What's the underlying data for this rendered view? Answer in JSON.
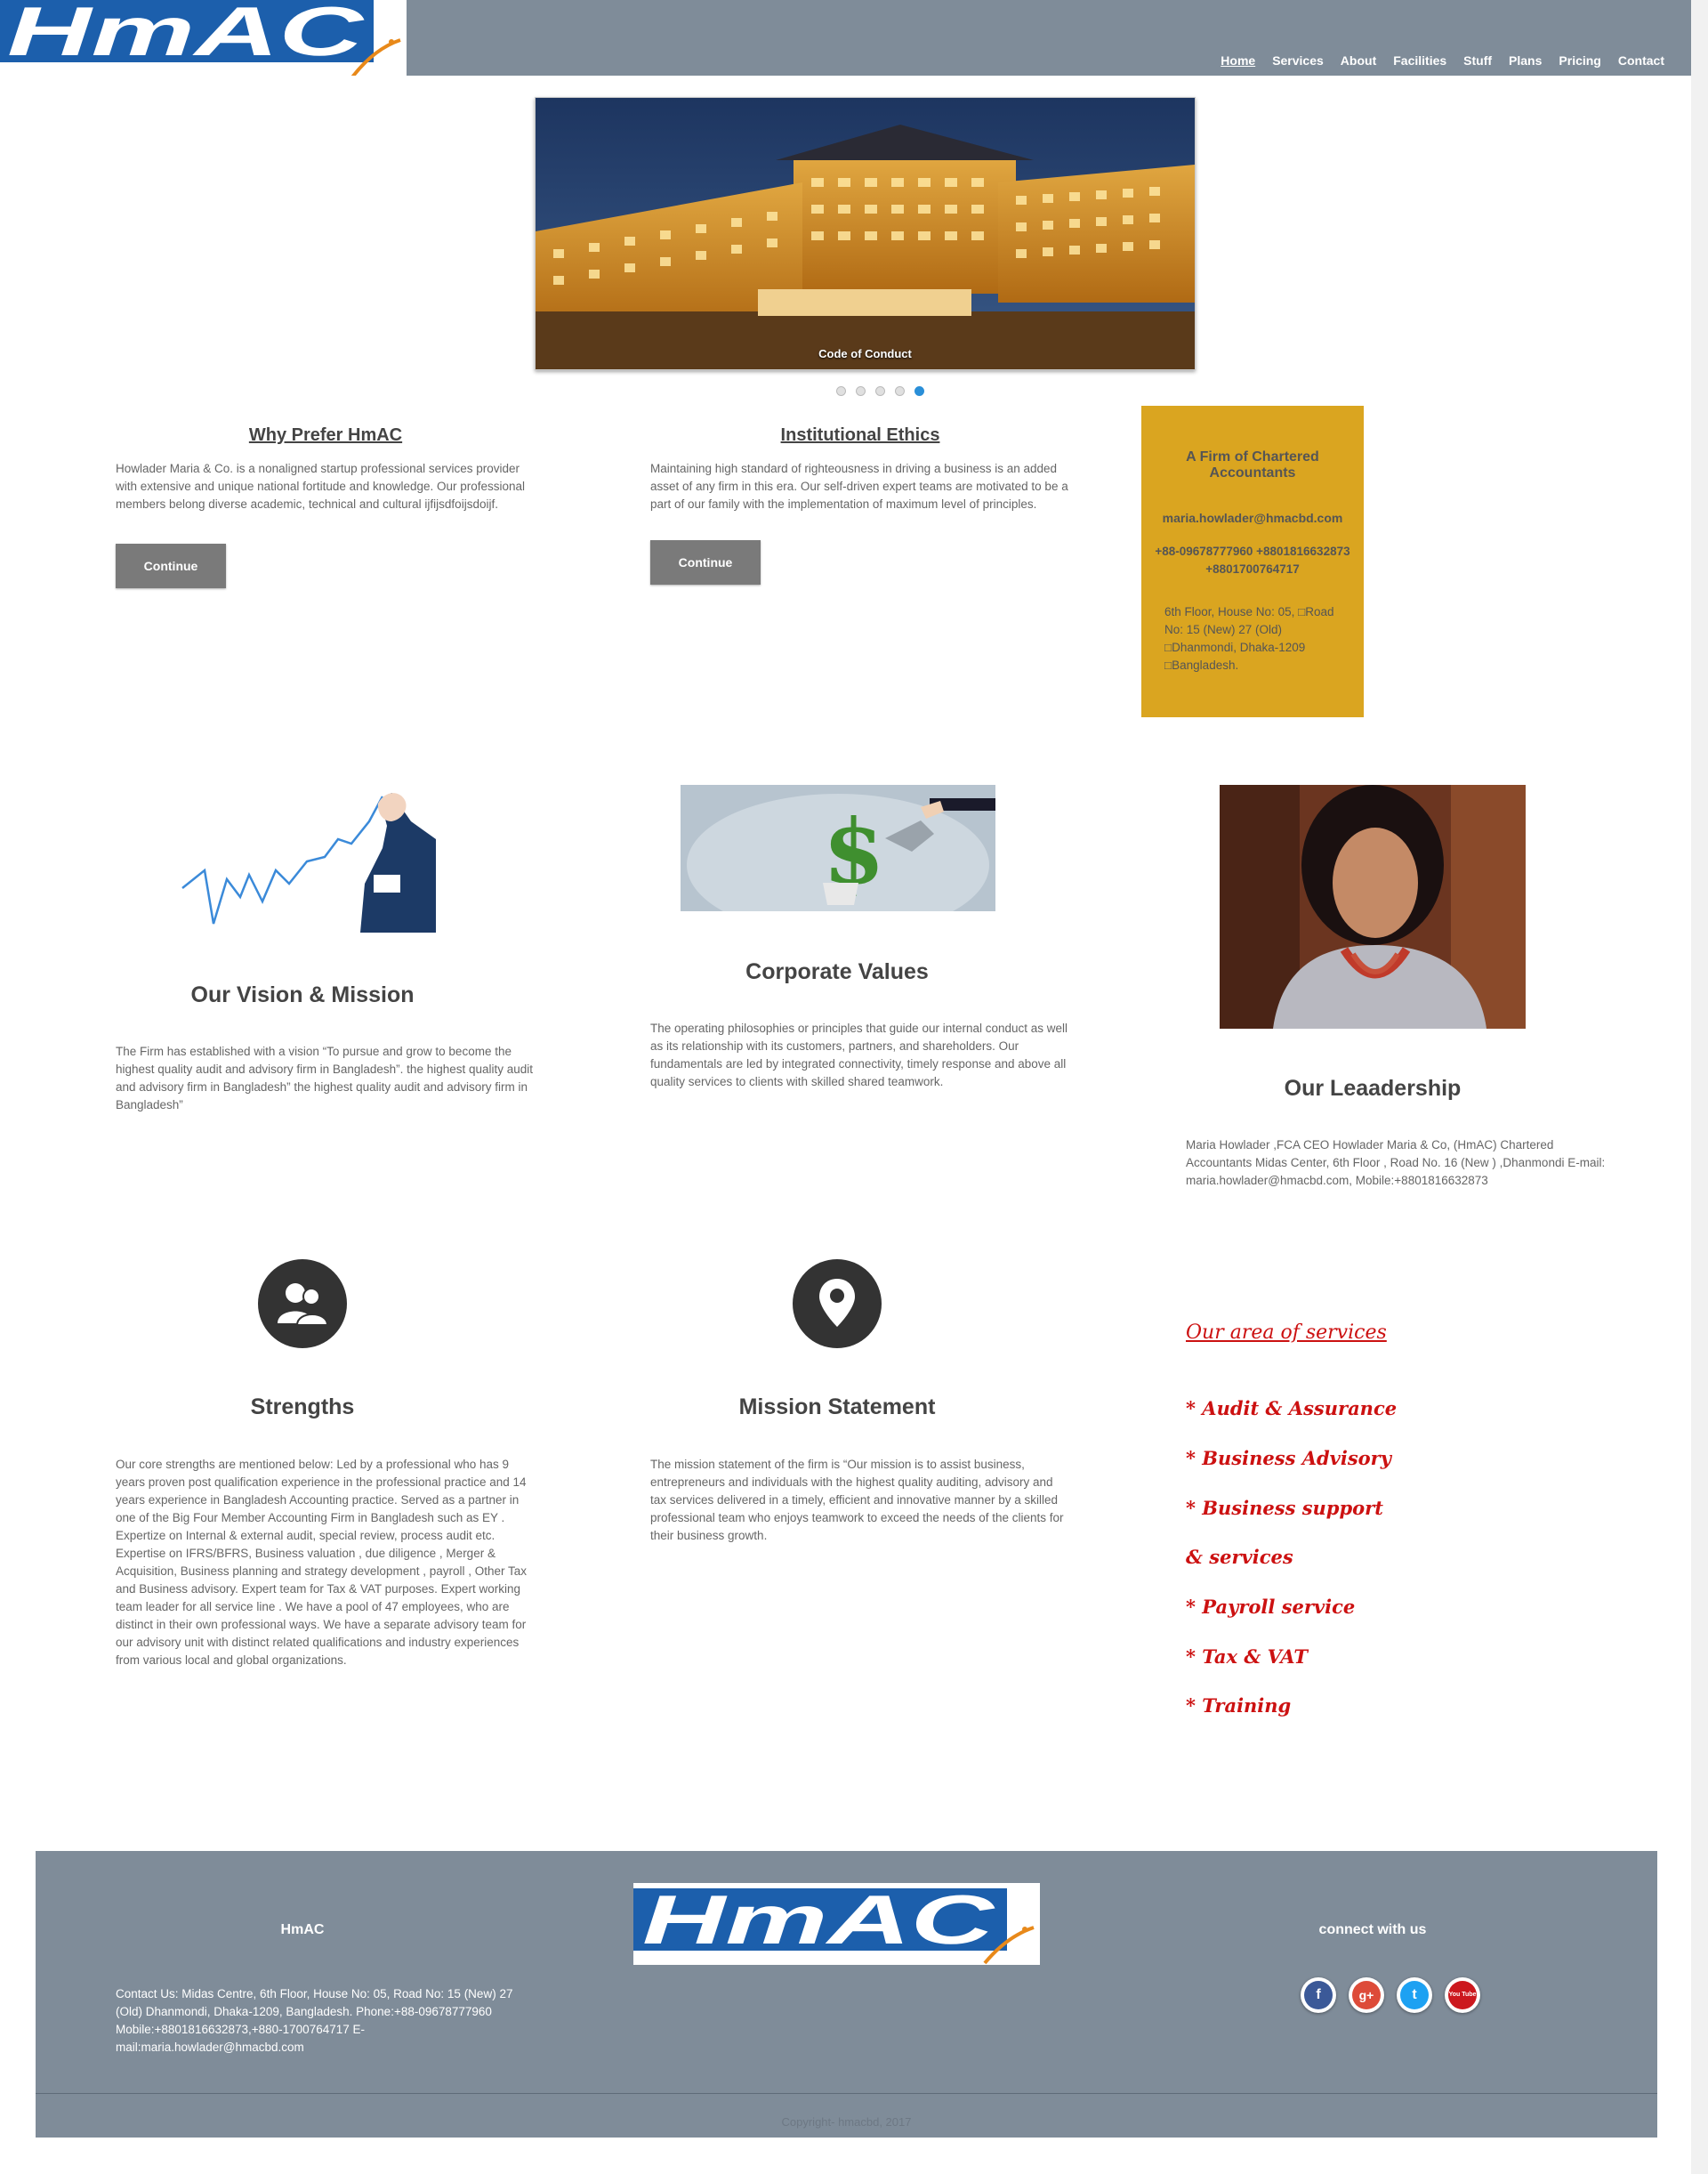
{
  "header": {
    "logo_text": "HmAC",
    "nav": [
      "Home",
      "Services",
      "About",
      "Facilities",
      "Stuff",
      "Plans",
      "Pricing",
      "Contact"
    ]
  },
  "slider": {
    "caption": "Code of Conduct",
    "slide_count": 5,
    "active_slide": 5
  },
  "why": {
    "title": "Why Prefer HmAC",
    "body": "Howlader Maria & Co. is a nonaligned startup professional services provider with extensive and unique national fortitude and knowledge. Our professional members belong diverse academic, technical and cultural ijfijsdfoijsdoijf.",
    "button": "Continue"
  },
  "ethics": {
    "title": "Institutional Ethics",
    "body": "Maintaining high standard of righteousness in driving a business is an added asset of any firm in this era. Our self-driven expert teams are motivated to be a part of our family with the implementation of maximum level of principles.",
    "button": "Continue"
  },
  "contact_box": {
    "title": "A Firm of Chartered Accountants",
    "email": "maria.howlader@hmacbd.com",
    "phone1": "+88-09678777960 +8801816632873",
    "phone2": "+8801700764717",
    "address": "6th Floor, House No: 05, □Road No: 15 (New) 27 (Old) □Dhanmondi, Dhaka-1209 □Bangladesh."
  },
  "vision": {
    "title": "Our Vision & Mission",
    "body": "The Firm has established with a vision “To pursue and grow to become the highest quality audit and advisory firm in Bangladesh”. the highest quality audit and advisory firm in Bangladesh” the highest quality audit and advisory firm in Bangladesh”"
  },
  "values": {
    "title": "Corporate Values",
    "body": "The operating philosophies or principles that guide our internal conduct as well as its relationship with its customers, partners, and shareholders. Our fundamentals are led by integrated connectivity, timely response and above all quality services to clients with skilled shared teamwork."
  },
  "leadership": {
    "title": "Our Leaadership",
    "body": "Maria Howlader ,FCA CEO Howlader Maria & Co, (HmAC) Chartered Accountants Midas Center, 6th Floor , Road No. 16 (New ) ,Dhanmondi E-mail: maria.howlader@hmacbd.com, Mobile:+8801816632873"
  },
  "strengths": {
    "title": "Strengths",
    "body": "Our core strengths are mentioned below: Led by a professional who has 9 years proven post qualification experience in the professional practice and 14 years experience in Bangladesh Accounting practice. Served as a partner in one of the Big Four Member Accounting Firm in Bangladesh such as EY . Expertize on Internal & external audit, special review, process audit etc. Expertise on IFRS/BFRS, Business valuation , due diligence , Merger & Acquisition, Business planning and strategy development , payroll , Other Tax and Business advisory. Expert team for Tax & VAT purposes. Expert working team leader for all service line . We have a pool of 47 employees, who are distinct in their own professional ways. We have a separate advisory team for our advisory unit with distinct related qualifications and industry experiences from various local and global organizations."
  },
  "mission": {
    "title": "Mission Statement",
    "body": "The mission statement of the firm is “Our mission is to assist business, entrepreneurs and individuals with the highest quality auditing, advisory and tax services delivered in a timely, efficient and innovative manner by a skilled professional team who enjoys teamwork to exceed the needs of the clients for their business growth."
  },
  "services": {
    "title": "Our area of services",
    "items": [
      "* Audit & Assurance",
      "* Business Advisory",
      "* Business support",
      "& services",
      "* Payroll service",
      "* Tax & VAT",
      "* Training"
    ]
  },
  "footer": {
    "brand": "HmAC",
    "contact": "Contact Us: Midas Centre, 6th Floor, House No: 05, Road No: 15 (New) 27 (Old) Dhanmondi, Dhaka-1209, Bangladesh. Phone:+88-09678777960 Mobile:+8801816632873,+880-1700764717 E-mail:maria.howlader@hmacbd.com",
    "connect": "connect with us",
    "social": [
      "f",
      "g+",
      "t",
      "You Tube"
    ],
    "copyright": "Copyright- hmacbd, 2017"
  },
  "colors": {
    "header_bg": "#7f8c99",
    "brand_blue": "#1c5fac",
    "logo_swoosh": "#e8891a",
    "contact_box": "#daa520",
    "services_red": "#cc1111",
    "dot_active": "#2a8fd8"
  },
  "icons": [
    "people-icon",
    "map-pin-icon",
    "facebook-icon",
    "google-plus-icon",
    "twitter-icon",
    "youtube-icon"
  ]
}
